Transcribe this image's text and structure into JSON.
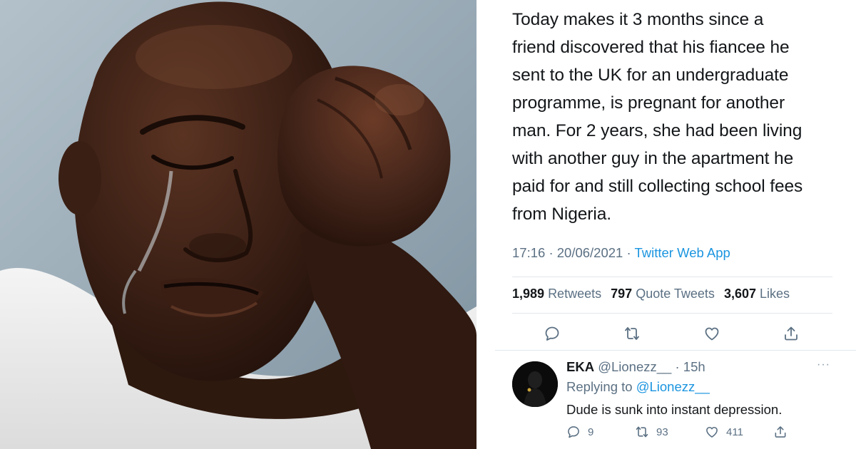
{
  "tweet": {
    "lines": [
      "Today makes it 3 months since a",
      "friend discovered that his fiancee he",
      "sent to the UK for an undergraduate",
      "programme, is pregnant for another",
      "man. For 2 years, she had been living",
      "with another guy in the apartment he",
      "paid for and still collecting school fees",
      "from Nigeria."
    ],
    "time": "17:16",
    "date": "20/06/2021",
    "source": "Twitter Web App",
    "stats": {
      "retweets_count": "1,989",
      "retweets_label": "Retweets",
      "quotes_count": "797",
      "quotes_label": "Quote Tweets",
      "likes_count": "3,607",
      "likes_label": "Likes"
    },
    "icons": [
      "reply-icon",
      "retweet-icon",
      "like-icon",
      "share-icon"
    ]
  },
  "reply": {
    "name": "EKA",
    "handle": "@Lionezz__",
    "age": "15h",
    "replying_prefix": "Replying to",
    "replying_to": "@Lionezz__",
    "text": "Dude is sunk into instant depression.",
    "reply_count": "9",
    "retweet_count": "93",
    "like_count": "411",
    "more": "···"
  },
  "colors": {
    "text": "#14171a",
    "muted": "#5b7083",
    "accent": "#1b95e0",
    "divider": "#e1e8ed",
    "photo_background": "#8fa1ad"
  }
}
